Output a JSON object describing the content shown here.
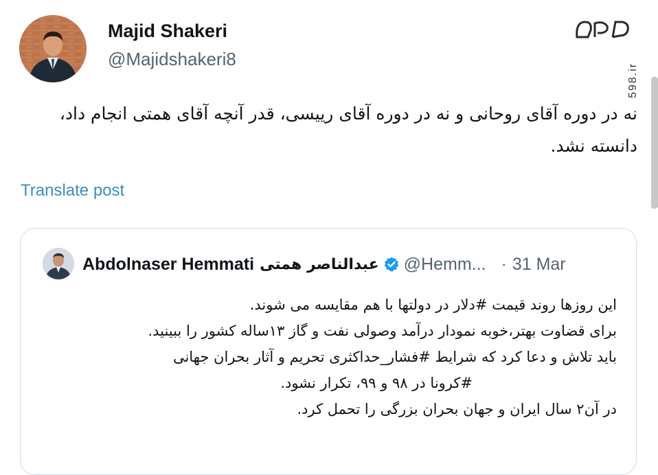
{
  "author": {
    "name": "Majid Shakeri",
    "handle": "@Majidshakeri8",
    "avatar_icon": "person-photo-avatar"
  },
  "watermark": {
    "logo_icon": "598-logo",
    "site_text": "598.ir"
  },
  "tweet": {
    "text": "نه در دوره آقای روحانی و نه در دوره آقای رییسی، قدر آنچه آقای همتی انجام داد، دانسته نشد.",
    "translate_label": "Translate post"
  },
  "quote": {
    "avatar_icon": "person-photo-avatar",
    "name": "Abdolnaser Hemmati",
    "name_fa": "عبدالناصر همتی",
    "verified_icon": "verified-badge-icon",
    "handle": "@Hemm...",
    "separator": "·",
    "date": "31 Mar",
    "lines": [
      "این روزها روند قیمت #دلار در دولتها با هم مقایسه می شوند.",
      "برای قضاوت بهتر،خوبه نمودار درآمد وصولی نفت و گاز ۱۳ساله کشور را ببینید.",
      "باید تلاش و دعا کرد که شرایط #فشار_حداکثری تحریم و آثار بحران جهانی",
      "#کرونا در ۹۸ و ۹۹، تکرار نشود.",
      "در آن۲ سال ایران و جهان بحران بزرگی را تحمل کرد."
    ]
  },
  "colors": {
    "text": "#0f1419",
    "secondary": "#536471",
    "link": "#3a8fb7",
    "verified": "#1d9bf0",
    "border": "#cfd9de"
  }
}
